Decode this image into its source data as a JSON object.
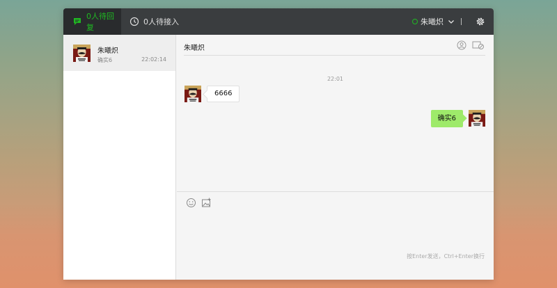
{
  "topbar": {
    "tab_pending_reply": "0人待回复",
    "tab_pending_access": "0人待接入",
    "user_name": "朱曦炽",
    "status_color": "#1fb922"
  },
  "conversations": [
    {
      "name": "朱曦炽",
      "last_message": "确实6",
      "time": "22:02:14"
    }
  ],
  "chat": {
    "title": "朱曦炽",
    "time_separator": "22:01",
    "messages": [
      {
        "direction": "incoming",
        "text": "6666"
      },
      {
        "direction": "outgoing",
        "text": "确实6"
      }
    ]
  },
  "input": {
    "hint": "按Enter发送，Ctrl+Enter换行"
  },
  "icons": {
    "tab_pending_reply": "chat-bubble-icon",
    "tab_pending_access": "clock-icon",
    "header_left": "transfer-user-icon",
    "header_right": "close-session-icon",
    "toolbar_left": "emoji-icon",
    "toolbar_right": "image-icon",
    "topbar_right": "gear-icon"
  },
  "colors": {
    "accent": "#1fb922",
    "outgoing_bubble": "#9eea6a",
    "topbar": "#3a3d3f"
  }
}
